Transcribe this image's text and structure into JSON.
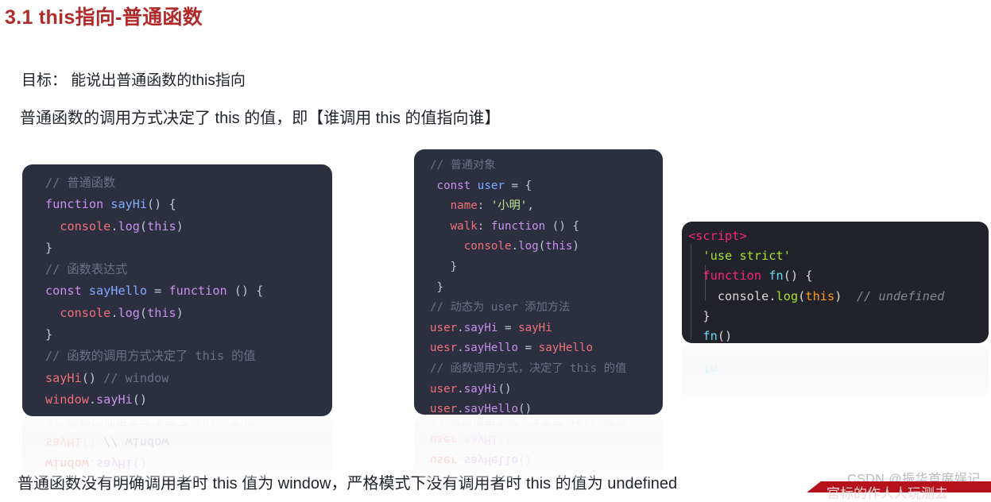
{
  "page": {
    "title": "3.1 this指向-普通函数",
    "title_color": "#b02a2a",
    "goal_line": "目标： 能说出普通函数的this指向",
    "rule_line": "普通函数的调用方式决定了 this 的值，即【谁调用 this 的值指向谁】",
    "summary_line": "普通函数没有明确调用者时 this 值为 window，严格模式下没有调用者时 this 的值为 undefined"
  },
  "watermark": {
    "text": "CSDN @振华首席娱记",
    "color": "#b9b9bd"
  },
  "bottom_banner": {
    "text": "官标的作人人玩测去",
    "color": "#b5121b"
  },
  "code_blocks": [
    {
      "id": "block-1",
      "theme": "navy",
      "background": "#2b2f40",
      "lines": [
        [
          {
            "t": "// 普通函数",
            "c": "comment"
          }
        ],
        [
          {
            "t": "function ",
            "c": "keyword"
          },
          {
            "t": "sayHi",
            "c": "func"
          },
          {
            "t": "() {",
            "c": "punct"
          }
        ],
        [
          {
            "t": "  ",
            "c": "punct"
          },
          {
            "t": "console",
            "c": "object"
          },
          {
            "t": ".",
            "c": "punct"
          },
          {
            "t": "log",
            "c": "method"
          },
          {
            "t": "(",
            "c": "punct"
          },
          {
            "t": "this",
            "c": "keyword"
          },
          {
            "t": ")",
            "c": "punct"
          }
        ],
        [
          {
            "t": "}",
            "c": "punct"
          }
        ],
        [
          {
            "t": "// 函数表达式",
            "c": "comment"
          }
        ],
        [
          {
            "t": "const ",
            "c": "keyword"
          },
          {
            "t": "sayHello",
            "c": "func"
          },
          {
            "t": " = ",
            "c": "punct"
          },
          {
            "t": "function",
            "c": "keyword"
          },
          {
            "t": " () {",
            "c": "punct"
          }
        ],
        [
          {
            "t": "  ",
            "c": "punct"
          },
          {
            "t": "console",
            "c": "object"
          },
          {
            "t": ".",
            "c": "punct"
          },
          {
            "t": "log",
            "c": "method"
          },
          {
            "t": "(",
            "c": "punct"
          },
          {
            "t": "this",
            "c": "keyword"
          },
          {
            "t": ")",
            "c": "punct"
          }
        ],
        [
          {
            "t": "}",
            "c": "punct"
          }
        ],
        [
          {
            "t": "// 函数的调用方式决定了 this 的值",
            "c": "comment"
          }
        ],
        [
          {
            "t": "sayHi",
            "c": "object"
          },
          {
            "t": "()",
            "c": "punct"
          },
          {
            "t": " // window",
            "c": "comment"
          }
        ],
        [
          {
            "t": "window",
            "c": "object"
          },
          {
            "t": ".",
            "c": "punct"
          },
          {
            "t": "sayHi",
            "c": "method"
          },
          {
            "t": "()",
            "c": "punct"
          }
        ]
      ]
    },
    {
      "id": "block-2",
      "theme": "navy",
      "background": "#2b2f40",
      "lines": [
        [
          {
            "t": "// 普通对象",
            "c": "comment"
          }
        ],
        [
          {
            "t": " const ",
            "c": "keyword"
          },
          {
            "t": "user",
            "c": "func"
          },
          {
            "t": " = {",
            "c": "punct"
          }
        ],
        [
          {
            "t": "   ",
            "c": "punct"
          },
          {
            "t": "name",
            "c": "prop"
          },
          {
            "t": ": ",
            "c": "punct"
          },
          {
            "t": "'小明'",
            "c": "string"
          },
          {
            "t": ",",
            "c": "punct"
          }
        ],
        [
          {
            "t": "   ",
            "c": "punct"
          },
          {
            "t": "walk",
            "c": "prop"
          },
          {
            "t": ": ",
            "c": "punct"
          },
          {
            "t": "function",
            "c": "keyword"
          },
          {
            "t": " () {",
            "c": "punct"
          }
        ],
        [
          {
            "t": "     ",
            "c": "punct"
          },
          {
            "t": "console",
            "c": "object"
          },
          {
            "t": ".",
            "c": "punct"
          },
          {
            "t": "log",
            "c": "method"
          },
          {
            "t": "(",
            "c": "punct"
          },
          {
            "t": "this",
            "c": "keyword"
          },
          {
            "t": ")",
            "c": "punct"
          }
        ],
        [
          {
            "t": "   }",
            "c": "punct"
          }
        ],
        [
          {
            "t": " }",
            "c": "punct"
          }
        ],
        [
          {
            "t": "// 动态为 user 添加方法",
            "c": "comment"
          }
        ],
        [
          {
            "t": "user",
            "c": "object"
          },
          {
            "t": ".",
            "c": "punct"
          },
          {
            "t": "sayHi",
            "c": "method"
          },
          {
            "t": " = ",
            "c": "punct"
          },
          {
            "t": "sayHi",
            "c": "object"
          }
        ],
        [
          {
            "t": "uesr",
            "c": "object"
          },
          {
            "t": ".",
            "c": "punct"
          },
          {
            "t": "sayHello",
            "c": "method"
          },
          {
            "t": " = ",
            "c": "punct"
          },
          {
            "t": "sayHello",
            "c": "object"
          }
        ],
        [
          {
            "t": "// 函数调用方式，决定了 this 的值",
            "c": "comment"
          }
        ],
        [
          {
            "t": "user",
            "c": "object"
          },
          {
            "t": ".",
            "c": "punct"
          },
          {
            "t": "sayHi",
            "c": "method"
          },
          {
            "t": "()",
            "c": "punct"
          }
        ],
        [
          {
            "t": "user",
            "c": "object"
          },
          {
            "t": ".",
            "c": "punct"
          },
          {
            "t": "sayHello",
            "c": "method"
          },
          {
            "t": "()",
            "c": "punct"
          }
        ]
      ]
    },
    {
      "id": "block-3",
      "theme": "monokai",
      "background": "#21222a",
      "lines": [
        [
          {
            "t": "<script>",
            "c": "m-tag"
          }
        ],
        [
          {
            "t": "  ",
            "c": "m-punct"
          },
          {
            "t": "'use strict'",
            "c": "m-string"
          }
        ],
        [
          {
            "t": "  ",
            "c": "m-punct"
          },
          {
            "t": "function ",
            "c": "m-keyword"
          },
          {
            "t": "fn",
            "c": "m-func"
          },
          {
            "t": "() {",
            "c": "m-punct"
          }
        ],
        [
          {
            "t": "    ",
            "c": "m-punct"
          },
          {
            "t": "console",
            "c": "m-object"
          },
          {
            "t": ".",
            "c": "m-punct"
          },
          {
            "t": "log",
            "c": "m-method"
          },
          {
            "t": "(",
            "c": "m-punct"
          },
          {
            "t": "this",
            "c": "m-this"
          },
          {
            "t": ")",
            "c": "m-punct"
          },
          {
            "t": "  // undefined",
            "c": "m-comment"
          }
        ],
        [
          {
            "t": "  }",
            "c": "m-punct"
          }
        ],
        [
          {
            "t": "  ",
            "c": "m-punct"
          },
          {
            "t": "fn",
            "c": "m-func"
          },
          {
            "t": "()",
            "c": "m-punct"
          }
        ]
      ]
    }
  ],
  "reflections": [
    {
      "id": "reflection-1",
      "lines": [
        [
          {
            "t": "window",
            "c": "object"
          },
          {
            "t": ".",
            "c": "punct"
          },
          {
            "t": "sayHi",
            "c": "method"
          },
          {
            "t": "()",
            "c": "punct"
          }
        ],
        [
          {
            "t": "sayHi",
            "c": "object"
          },
          {
            "t": "()",
            "c": "punct"
          },
          {
            "t": " // window",
            "c": "comment"
          }
        ],
        [
          {
            "t": "// 函数的调用方式决定了 this 的值",
            "c": "comment"
          }
        ]
      ]
    },
    {
      "id": "reflection-2",
      "lines": [
        [
          {
            "t": "user",
            "c": "object"
          },
          {
            "t": ".",
            "c": "punct"
          },
          {
            "t": "sayHello",
            "c": "method"
          },
          {
            "t": "()",
            "c": "punct"
          }
        ],
        [
          {
            "t": "user",
            "c": "object"
          },
          {
            "t": ".",
            "c": "punct"
          },
          {
            "t": "sayHi",
            "c": "method"
          },
          {
            "t": "()",
            "c": "punct"
          }
        ],
        [
          {
            "t": "// 函数调用方式，决定了 this 的值",
            "c": "comment"
          }
        ]
      ]
    },
    {
      "id": "reflection-3",
      "lines": [
        [
          {
            "t": "  ",
            "c": "m-punct"
          },
          {
            "t": "fn",
            "c": "m-func"
          },
          {
            "t": "()",
            "c": "m-punct"
          }
        ],
        [
          {
            "t": "  }",
            "c": "m-punct"
          }
        ]
      ]
    }
  ],
  "syntax_colors": {
    "comment": "#6b7089",
    "keyword": "#c792ea",
    "func": "#82aaff",
    "method": "#c792ea",
    "object": "#f07178",
    "prop": "#f07178",
    "string": "#c3e88d",
    "punct": "#bfc7d5",
    "m_tag": "#f92672",
    "m_string": "#a6e22e",
    "m_keyword": "#f92672",
    "m_func": "#66d9ef",
    "m_object": "#d8d8d2",
    "m_method": "#a6e22e",
    "m_this": "#fd971f",
    "m_comment": "#88898f",
    "m_punct": "#d8d8d2"
  }
}
